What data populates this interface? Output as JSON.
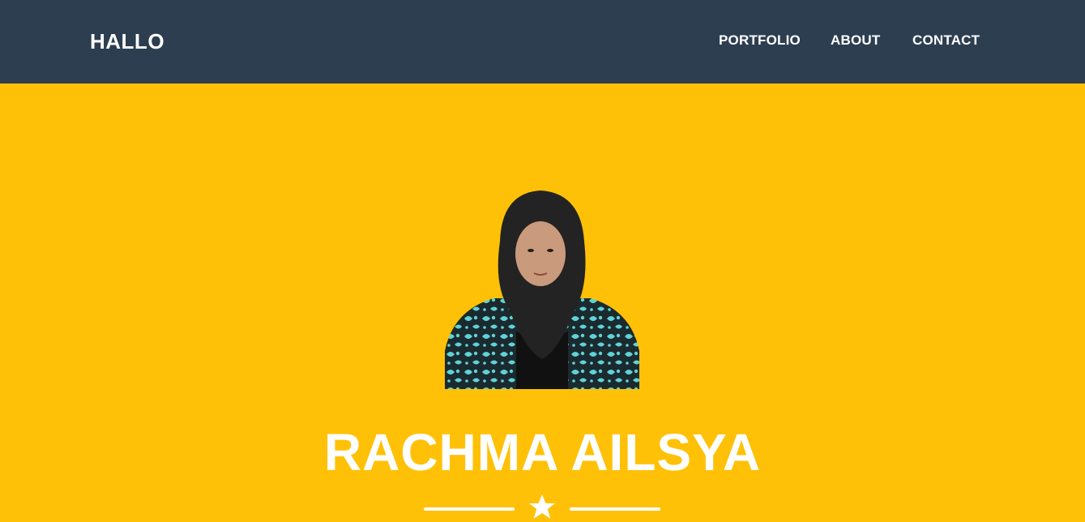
{
  "navbar": {
    "brand": "HALLO",
    "links": [
      {
        "label": "PORTFOLIO"
      },
      {
        "label": "ABOUT"
      },
      {
        "label": "CONTACT"
      }
    ]
  },
  "masthead": {
    "name": "RACHMA AILSYA",
    "avatar_icon": "profile-photo",
    "divider_icon": "star-icon"
  },
  "colors": {
    "navbar_bg": "#2c3e50",
    "masthead_bg": "#ffc107",
    "text": "#ffffff"
  }
}
